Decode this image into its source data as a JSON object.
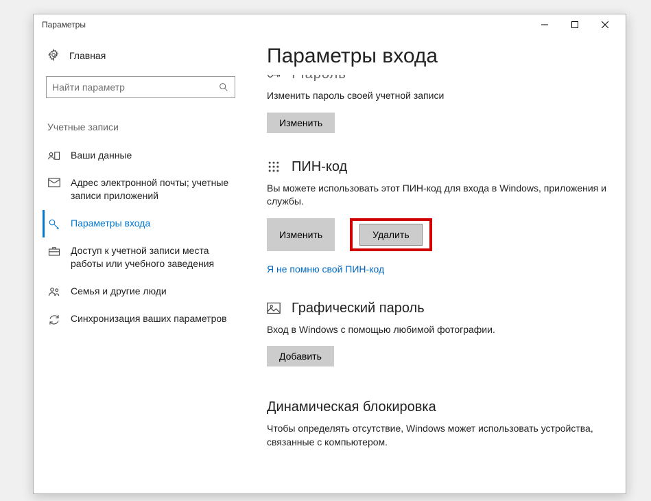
{
  "window": {
    "title": "Параметры"
  },
  "sidebar": {
    "home": "Главная",
    "search_placeholder": "Найти параметр",
    "section_label": "Учетные записи",
    "items": [
      {
        "label": "Ваши данные"
      },
      {
        "label": "Адрес электронной почты; учетные записи приложений"
      },
      {
        "label": "Параметры входа"
      },
      {
        "label": "Доступ к учетной записи места работы или учебного заведения"
      },
      {
        "label": "Семья и другие люди"
      },
      {
        "label": "Синхронизация ваших параметров"
      }
    ]
  },
  "content": {
    "header": "Параметры входа",
    "password": {
      "title_partial": "Пароль",
      "desc": "Изменить пароль своей учетной записи",
      "btn_change": "Изменить"
    },
    "pin": {
      "title": "ПИН-код",
      "desc": "Вы можете использовать этот ПИН-код для входа в Windows, приложения и службы.",
      "btn_change": "Изменить",
      "btn_delete": "Удалить",
      "link_forgot": "Я не помню свой ПИН-код"
    },
    "picture": {
      "title": "Графический пароль",
      "desc": "Вход в Windows с помощью любимой фотографии.",
      "btn_add": "Добавить"
    },
    "dynamic": {
      "title": "Динамическая блокировка",
      "desc": "Чтобы определять отсутствие, Windows может использовать устройства, связанные с компьютером."
    }
  }
}
